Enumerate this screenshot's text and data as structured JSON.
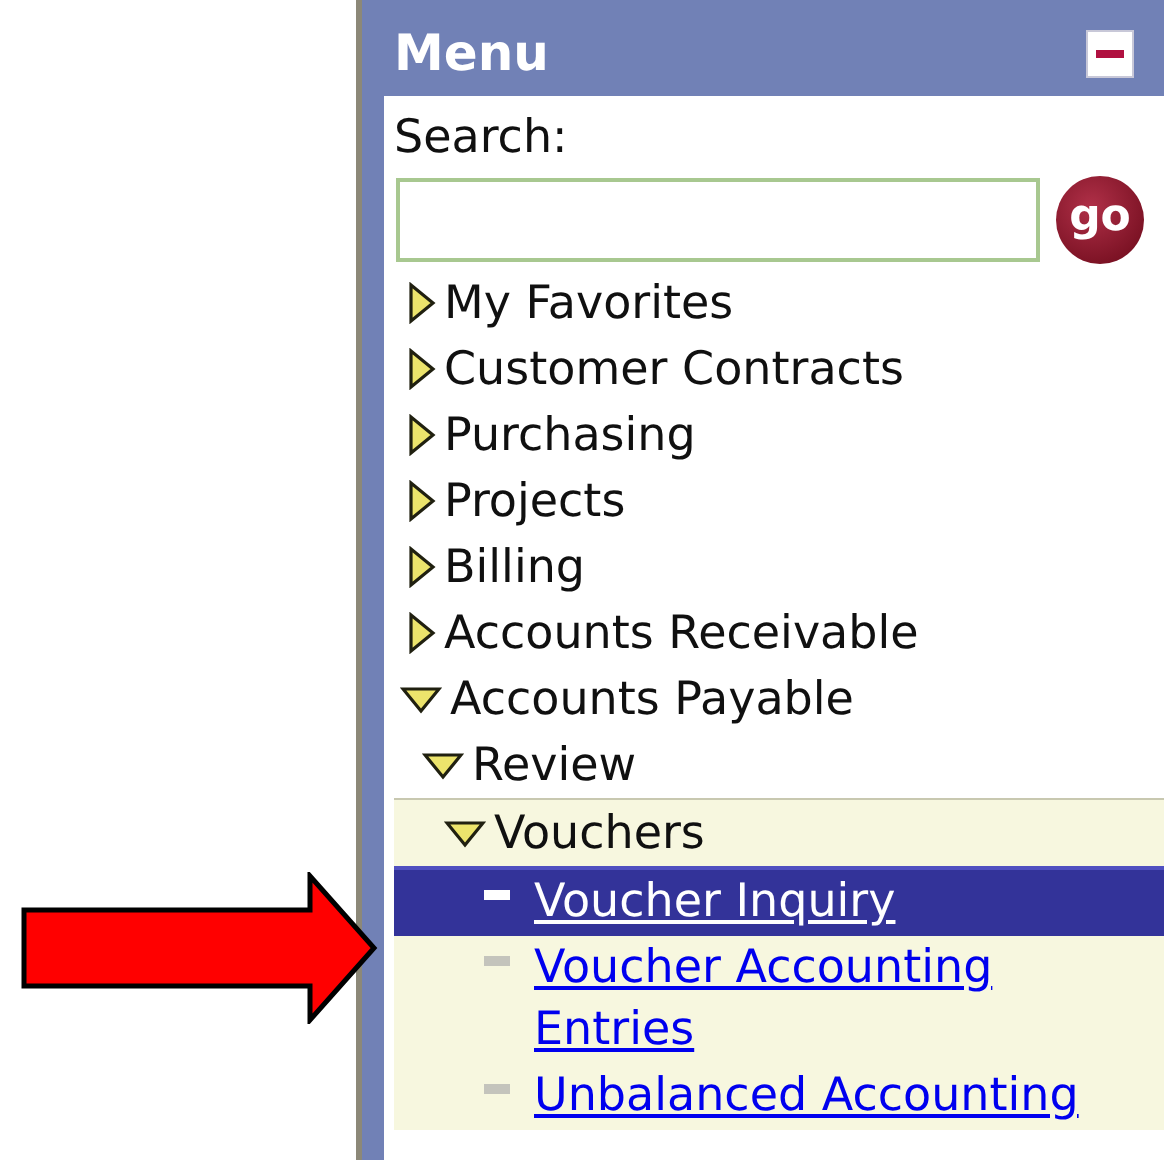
{
  "menu": {
    "title": "Menu",
    "search": {
      "label": "Search:",
      "button": "go"
    },
    "items": [
      {
        "kind": "folder",
        "label": "My Favorites",
        "expanded": false
      },
      {
        "kind": "folder",
        "label": "Customer Contracts",
        "expanded": false
      },
      {
        "kind": "folder",
        "label": "Purchasing",
        "expanded": false
      },
      {
        "kind": "folder",
        "label": "Projects",
        "expanded": false
      },
      {
        "kind": "folder",
        "label": "Billing",
        "expanded": false
      },
      {
        "kind": "folder",
        "label": "Accounts Receivable",
        "expanded": false
      },
      {
        "kind": "folder",
        "label": "Accounts Payable",
        "expanded": true,
        "children": [
          {
            "kind": "folder",
            "label": "Review",
            "expanded": true,
            "children": [
              {
                "kind": "folder",
                "label": "Vouchers",
                "expanded": true,
                "children": [
                  {
                    "kind": "link",
                    "label": "Voucher Inquiry",
                    "selected": true
                  },
                  {
                    "kind": "link",
                    "label": "Voucher Accounting Entries",
                    "selected": false
                  },
                  {
                    "kind": "link",
                    "label": "Unbalanced Accounting",
                    "selected": false
                  }
                ]
              }
            ]
          }
        ]
      }
    ]
  }
}
